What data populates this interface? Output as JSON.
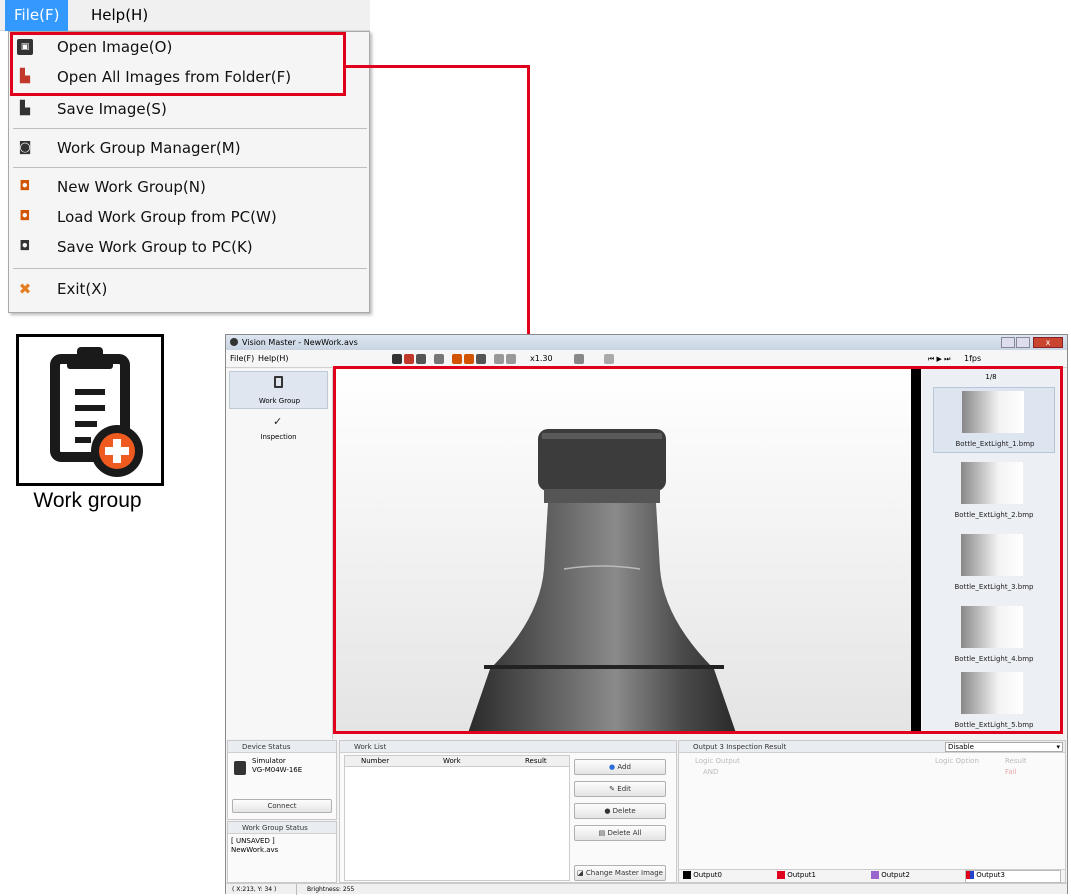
{
  "menu": {
    "file": "File(F)",
    "help": "Help(H)"
  },
  "dropdown": {
    "items": [
      {
        "label": "Open Image(O)",
        "icon": "open-image-icon"
      },
      {
        "label": "Open All Images from Folder(F)",
        "icon": "folder-icon"
      },
      {
        "label": "Save Image(S)",
        "icon": "save-icon"
      },
      {
        "label": "Work Group Manager(M)",
        "icon": "work-group-manager-icon"
      },
      {
        "label": "New Work Group(N)",
        "icon": "new-work-group-icon"
      },
      {
        "label": "Load Work Group from PC(W)",
        "icon": "load-icon"
      },
      {
        "label": "Save Work Group to PC(K)",
        "icon": "save-work-group-icon"
      },
      {
        "label": "Exit(X)",
        "icon": "close-icon"
      }
    ]
  },
  "workgroup_icon": {
    "label": "Work group"
  },
  "app": {
    "title": "Vision Master - NewWork.avs",
    "menu_file": "File(F)",
    "menu_help": "Help(H)",
    "zoom": "x1.30",
    "fps": "1fps",
    "nav": {
      "work_group": "Work Group",
      "inspection": "Inspection"
    },
    "thumbs": {
      "counter": "1/8",
      "items": [
        "Bottle_ExtLight_1.bmp",
        "Bottle_ExtLight_2.bmp",
        "Bottle_ExtLight_3.bmp",
        "Bottle_ExtLight_4.bmp",
        "Bottle_ExtLight_5.bmp"
      ]
    },
    "device": {
      "header": "Device Status",
      "name": "Simulator",
      "model": "VG-M04W-16E",
      "connect": "Connect"
    },
    "wgstatus": {
      "header": "Work Group Status",
      "line1": "[ UNSAVED ]",
      "line2": "NewWork.avs"
    },
    "worklist": {
      "header": "Work List",
      "columns": [
        "Number",
        "Work",
        "Result"
      ]
    },
    "buttons": {
      "add": "Add",
      "edit": "Edit",
      "delete": "Delete",
      "delete_all": "Delete All",
      "change_master": "Change Master Image"
    },
    "output": {
      "header": "Output 3 Inspection Result",
      "disable": "Disable",
      "logic_output": "Logic Output",
      "logic_option": "Logic Option",
      "result": "Result",
      "and": "AND",
      "fail": "Fail",
      "tabs": [
        {
          "label": "Output0",
          "color": "#000000"
        },
        {
          "label": "Output1",
          "color": "#e0001b"
        },
        {
          "label": "Output2",
          "color": "#9966cc"
        },
        {
          "label": "Output3",
          "color": "#2244cc"
        }
      ]
    },
    "status": {
      "coords": "( X:213, Y: 34 )",
      "brightness": "Brightness: 255"
    }
  },
  "colors": {
    "callout": "#e0001b",
    "menu_selected": "#3399ff"
  }
}
